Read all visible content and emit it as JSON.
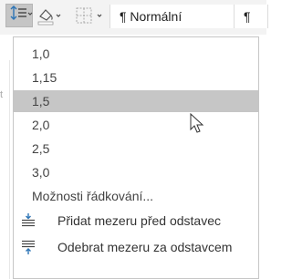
{
  "ribbon": {
    "tools": [
      {
        "name": "line-spacing",
        "icon": "line-spacing-icon",
        "state": "pressed"
      },
      {
        "name": "shading",
        "icon": "shading-bucket-icon"
      },
      {
        "name": "borders",
        "icon": "borders-icon"
      }
    ],
    "style_gallery": {
      "normal_label": "¶ Normální",
      "next_label": "¶"
    }
  },
  "document": {
    "edge_char": "t"
  },
  "menu": {
    "spacing_options": [
      {
        "label": "1,0"
      },
      {
        "label": "1,15"
      },
      {
        "label": "1,5",
        "selected": true
      },
      {
        "label": "2,0"
      },
      {
        "label": "2,5"
      },
      {
        "label": "3,0"
      }
    ],
    "options_label": "Možnosti řádkování...",
    "actions": [
      {
        "label": "Přidat mezeru před odstavec",
        "icon": "add-space-before-icon"
      },
      {
        "label": "Odebrat mezeru za odstavcem",
        "icon": "remove-space-after-icon"
      }
    ]
  },
  "colors": {
    "selection": "#c6c6c6",
    "icon_blue": "#2e75b6",
    "text": "#444444"
  }
}
